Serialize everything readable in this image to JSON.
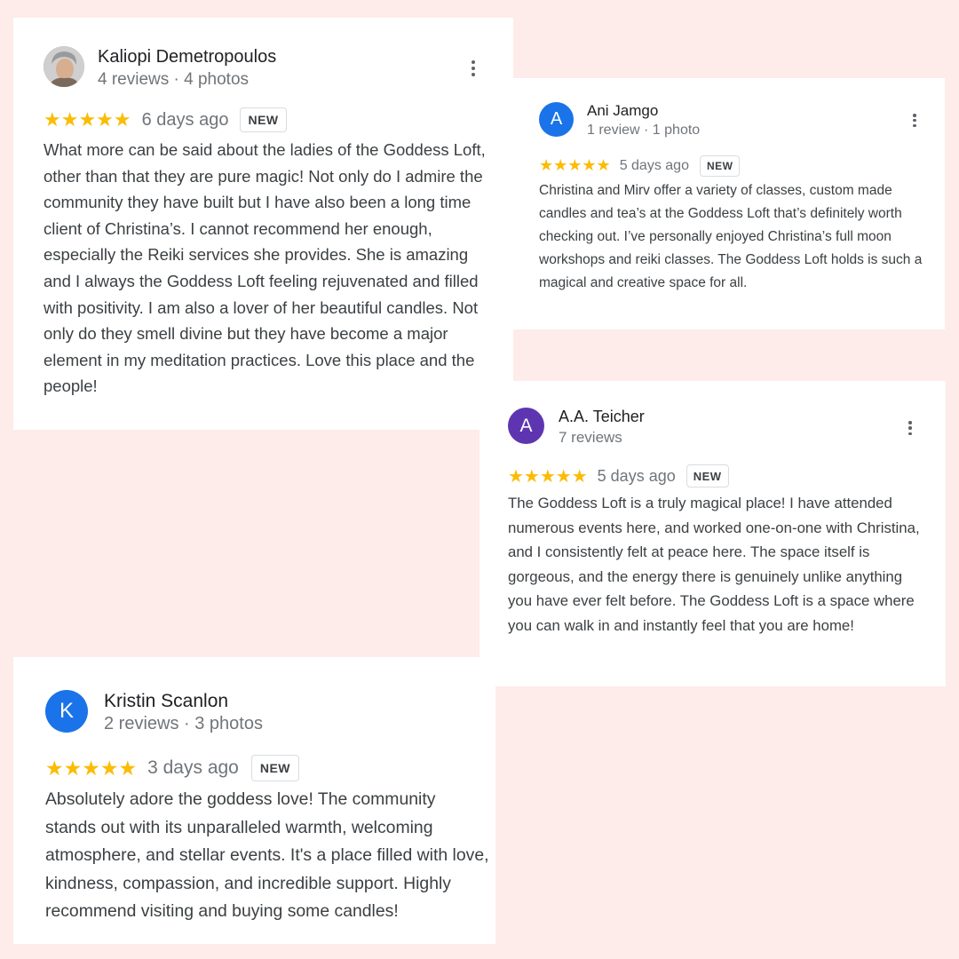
{
  "colors": {
    "background": "#fdecea",
    "card": "#ffffff",
    "star": "#fbbc04",
    "avatar_blue": "#1a73e8",
    "avatar_purple": "#5e35b1"
  },
  "reviews": [
    {
      "name": "Kaliopi Demetropoulos",
      "meta": "4 reviews · 4 photos",
      "avatar": "profile-photo",
      "stars": "★★★★★",
      "rating": 5,
      "date": "6 days ago",
      "badge": "NEW",
      "text": "What more can be said about the ladies of the Goddess Loft, other than that they are pure magic! Not only do I admire the community they have built but I have also been a long time client of Christina’s. I cannot recommend her enough, especially the Reiki services she provides. She is amazing and I always the Goddess Loft feeling rejuvenated and filled with positivity. I am also a lover of her beautiful candles. Not only do they smell divine but they have become a major element in my meditation practices. Love this place and the people!"
    },
    {
      "name": "Ani Jamgo",
      "meta": "1 review · 1 photo",
      "avatar": "A",
      "stars": "★★★★★",
      "rating": 5,
      "date": "5 days ago",
      "badge": "NEW",
      "text": "Christina and Mirv offer a variety of classes, custom made candles and tea’s at the Goddess Loft that’s definitely worth checking out. I’ve personally enjoyed Christina’s full moon workshops and reiki classes. The Goddess Loft holds is such a magical and creative space for all."
    },
    {
      "name": "A.A. Teicher",
      "meta": "7 reviews",
      "avatar": "A",
      "stars": "★★★★★",
      "rating": 5,
      "date": "5 days ago",
      "badge": "NEW",
      "text": "The Goddess Loft is a truly magical place! I have attended numerous events here, and worked one-on-one with Christina, and I consistently felt at peace here. The space itself is gorgeous, and the energy there is genuinely unlike anything you have ever felt before. The Goddess Loft is a space where you can walk in and instantly feel that you are home!"
    },
    {
      "name": "Kristin Scanlon",
      "meta": "2 reviews · 3 photos",
      "avatar": "K",
      "stars": "★★★★★",
      "rating": 5,
      "date": "3 days ago",
      "badge": "NEW",
      "text": "Absolutely adore the goddess love! The community stands out with its unparalleled warmth, welcoming atmosphere, and stellar events. It's a place filled with love, kindness, compassion, and incredible support. Highly recommend visiting and buying some candles!"
    }
  ]
}
